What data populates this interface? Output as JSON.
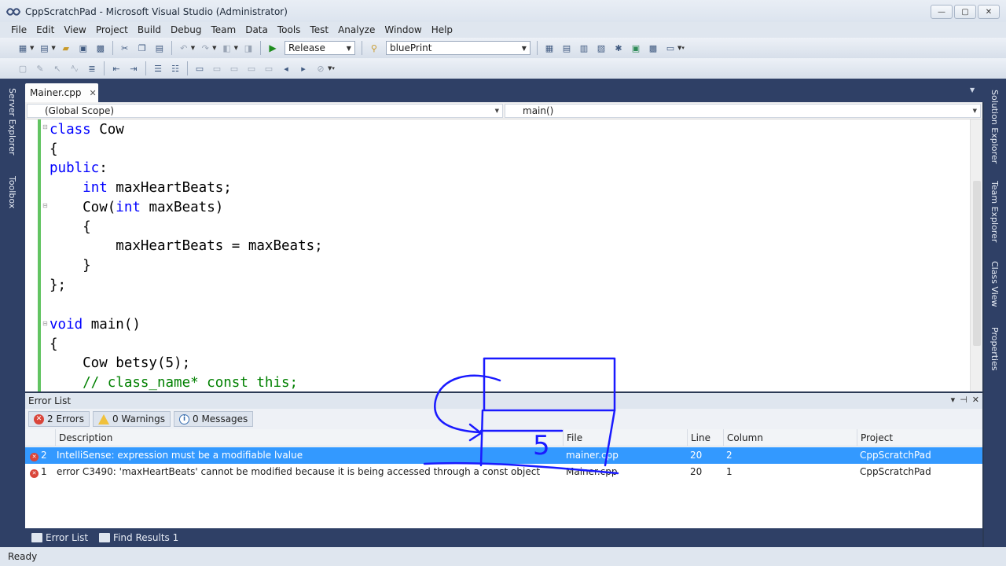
{
  "window": {
    "title": "CppScratchPad - Microsoft Visual Studio (Administrator)",
    "minimize": "—",
    "maximize": "▢",
    "close": "✕"
  },
  "menu": [
    "File",
    "Edit",
    "View",
    "Project",
    "Build",
    "Debug",
    "Team",
    "Data",
    "Tools",
    "Test",
    "Analyze",
    "Window",
    "Help"
  ],
  "toolbar": {
    "configuration": "Release",
    "find_text": "bluePrint"
  },
  "left_strip": {
    "server_explorer": "Server Explorer",
    "toolbox": "Toolbox"
  },
  "right_strip": {
    "solution_explorer": "Solution Explorer",
    "team_explorer": "Team Explorer",
    "class_view": "Class View",
    "properties": "Properties"
  },
  "document": {
    "tab": "Mainer.cpp",
    "scope": "(Global Scope)",
    "member": "main()"
  },
  "code": [
    "class Cow",
    "{",
    "public:",
    "    int maxHeartBeats;",
    "    Cow(int maxBeats)",
    "    {",
    "        maxHeartBeats = maxBeats;",
    "    }",
    "};",
    "",
    "void main()",
    "{",
    "    Cow betsy(5);",
    "    // class_name* const this;"
  ],
  "error_list": {
    "title": "Error List",
    "filters": {
      "errors": "2 Errors",
      "warnings": "0 Warnings",
      "messages": "0 Messages"
    },
    "columns": [
      "Description",
      "File",
      "Line",
      "Column",
      "Project"
    ],
    "rows": [
      {
        "num": "2",
        "description": "IntelliSense: expression must be a modifiable lvalue",
        "file": "mainer.cpp",
        "line": "20",
        "column": "2",
        "project": "CppScratchPad"
      },
      {
        "num": "1",
        "description": "error C3490: 'maxHeartBeats' cannot be modified because it is being accessed through a const object",
        "file": "Mainer.cpp",
        "line": "20",
        "column": "1",
        "project": "CppScratchPad"
      }
    ]
  },
  "bottom_tabs": {
    "error_list": "Error List",
    "find_results": "Find Results 1"
  },
  "status": "Ready",
  "annotation": {
    "digit": "5",
    "ink_color": "#1a1aff"
  },
  "colors": {
    "chrome_dark": "#2f4066",
    "selection": "#3399ff",
    "keyword": "#0000ff",
    "comment": "#008000",
    "change_bar": "#62c462"
  }
}
